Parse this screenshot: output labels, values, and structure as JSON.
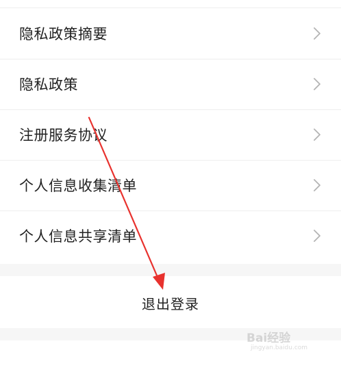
{
  "list": {
    "items": [
      {
        "label": "隐私政策摘要",
        "chevron": "chevron-right-icon"
      },
      {
        "label": "隐私政策",
        "chevron": "chevron-right-icon"
      },
      {
        "label": "注册服务协议",
        "chevron": "chevron-right-icon"
      },
      {
        "label": "个人信息收集清单",
        "chevron": "chevron-right-icon"
      },
      {
        "label": "个人信息共享清单",
        "chevron": "chevron-right-icon"
      }
    ]
  },
  "logout": {
    "label": "退出登录"
  },
  "watermark": {
    "brand": "Bai经验",
    "site": "jingyan.baidu.com"
  },
  "colors": {
    "text": "#222222",
    "chevron": "#b3b3b3",
    "divider": "#eeeeee",
    "band": "#f6f6f6",
    "annotation": "#e8322e"
  }
}
